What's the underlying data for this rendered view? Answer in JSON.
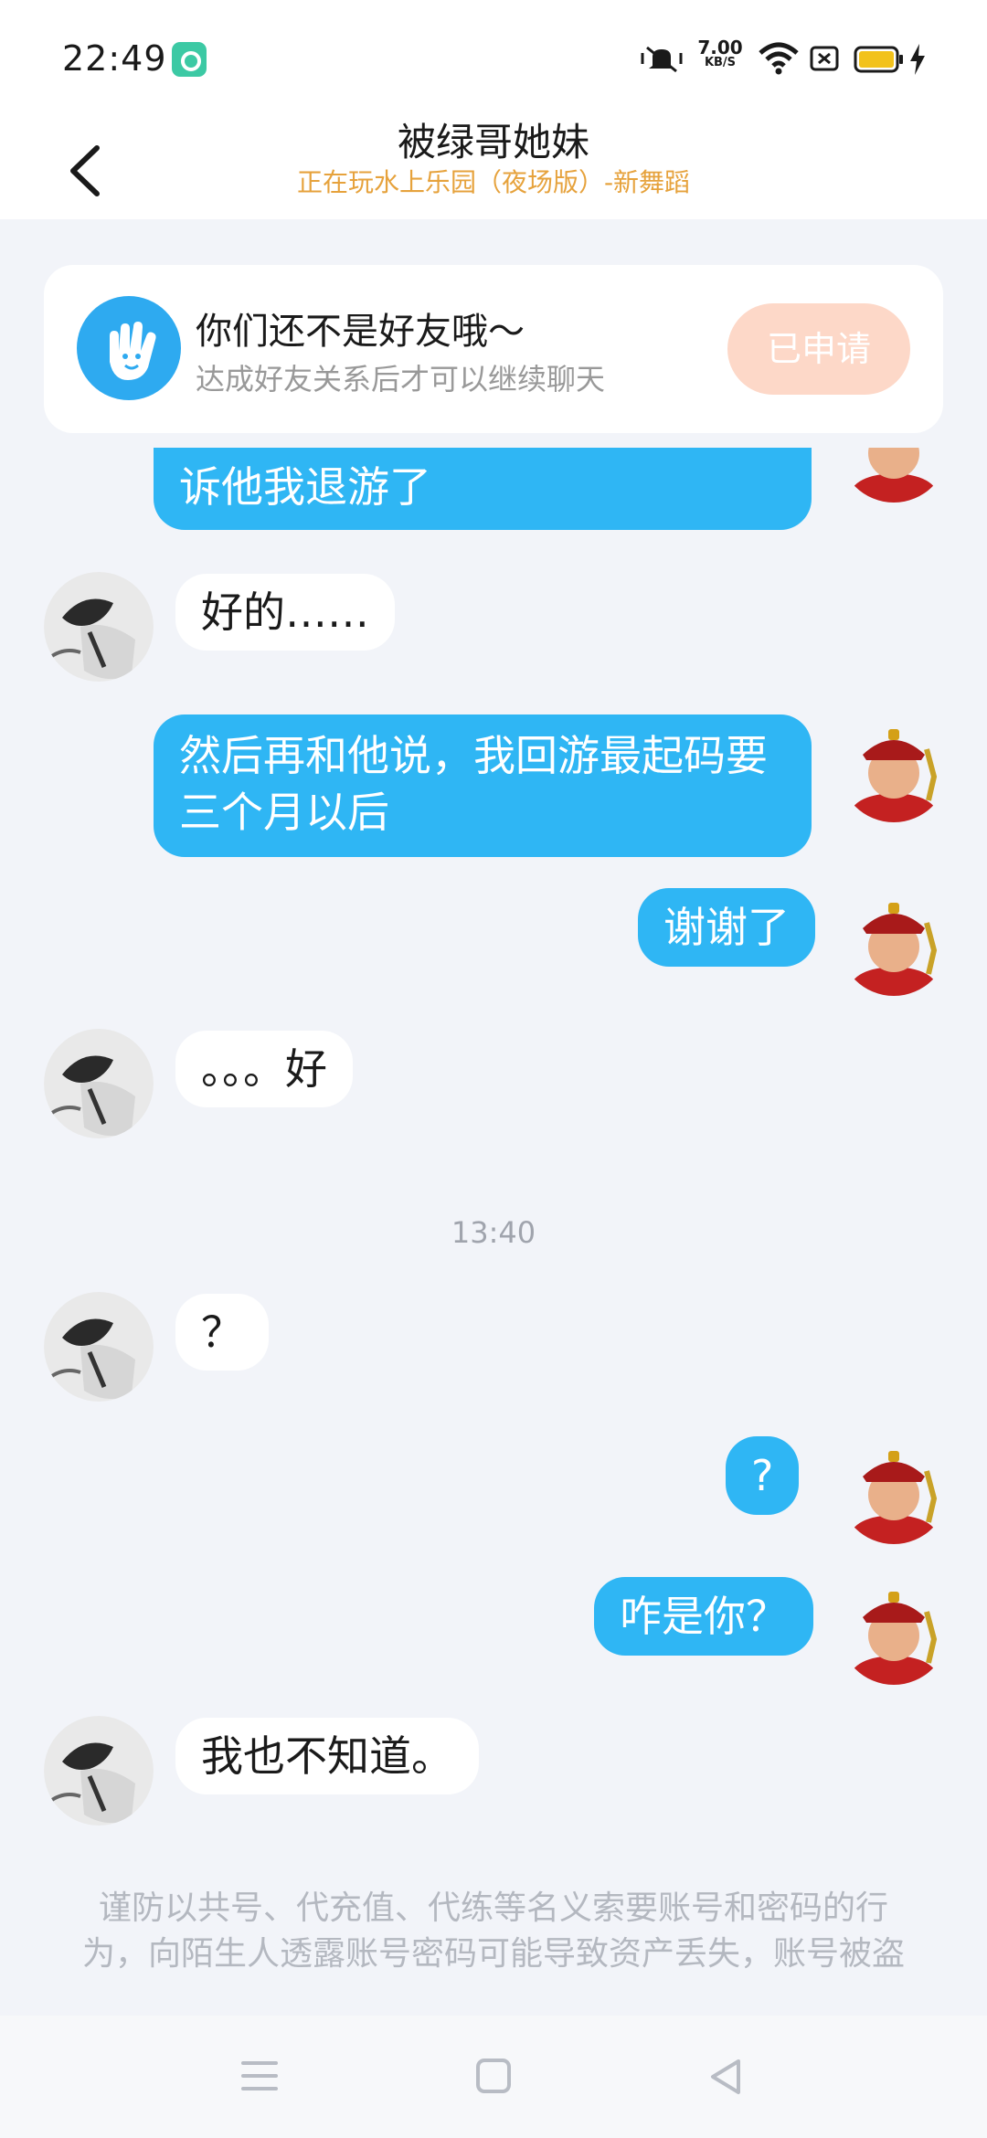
{
  "status_bar": {
    "time": "22:49",
    "net_speed_value": "7.00",
    "net_speed_unit": "KB/S",
    "icons": [
      "notification-app-icon",
      "vibrate-mute-icon",
      "wifi-icon",
      "sim-off-icon",
      "battery-icon",
      "charging-icon"
    ]
  },
  "header": {
    "title": "被绿哥她妹",
    "subtitle": "正在玩水上乐园（夜场版）-新舞蹈",
    "back_icon": "chevron-left-icon"
  },
  "friend_notice": {
    "title": "你们还不是好友哦～",
    "subtitle": "达成好友关系后才可以继续聊天",
    "button_label": "已申请",
    "icon": "hand-icon"
  },
  "messages": [
    {
      "side": "out",
      "text": "诉他我退游了"
    },
    {
      "side": "in",
      "text": "好的……"
    },
    {
      "side": "out",
      "line1": "然后再和他说，我回游最起码要",
      "line2": "三个月以后"
    },
    {
      "side": "out",
      "text": "谢谢了"
    },
    {
      "side": "in",
      "text": "。。。好"
    },
    {
      "timestamp": "13:40"
    },
    {
      "side": "in",
      "text": "？"
    },
    {
      "side": "out",
      "text": "?"
    },
    {
      "side": "out",
      "text": "咋是你？"
    },
    {
      "side": "in",
      "text": "我也不知道。"
    }
  ],
  "warning": {
    "line1": "谨防以共号、代充值、代练等名义索要账号和密码的行",
    "line2": "为，向陌生人透露账号密码可能导致资产丢失，账号被盗"
  },
  "nav_bar": {
    "icons": [
      "menu-icon",
      "home-square-icon",
      "back-triangle-icon"
    ]
  },
  "colors": {
    "outgoing_bubble": "#2fb6f4",
    "incoming_bubble": "#ffffff",
    "background": "#f2f4f9",
    "subtitle_accent": "#e6a23c",
    "applied_button": "#fdd8c8"
  }
}
